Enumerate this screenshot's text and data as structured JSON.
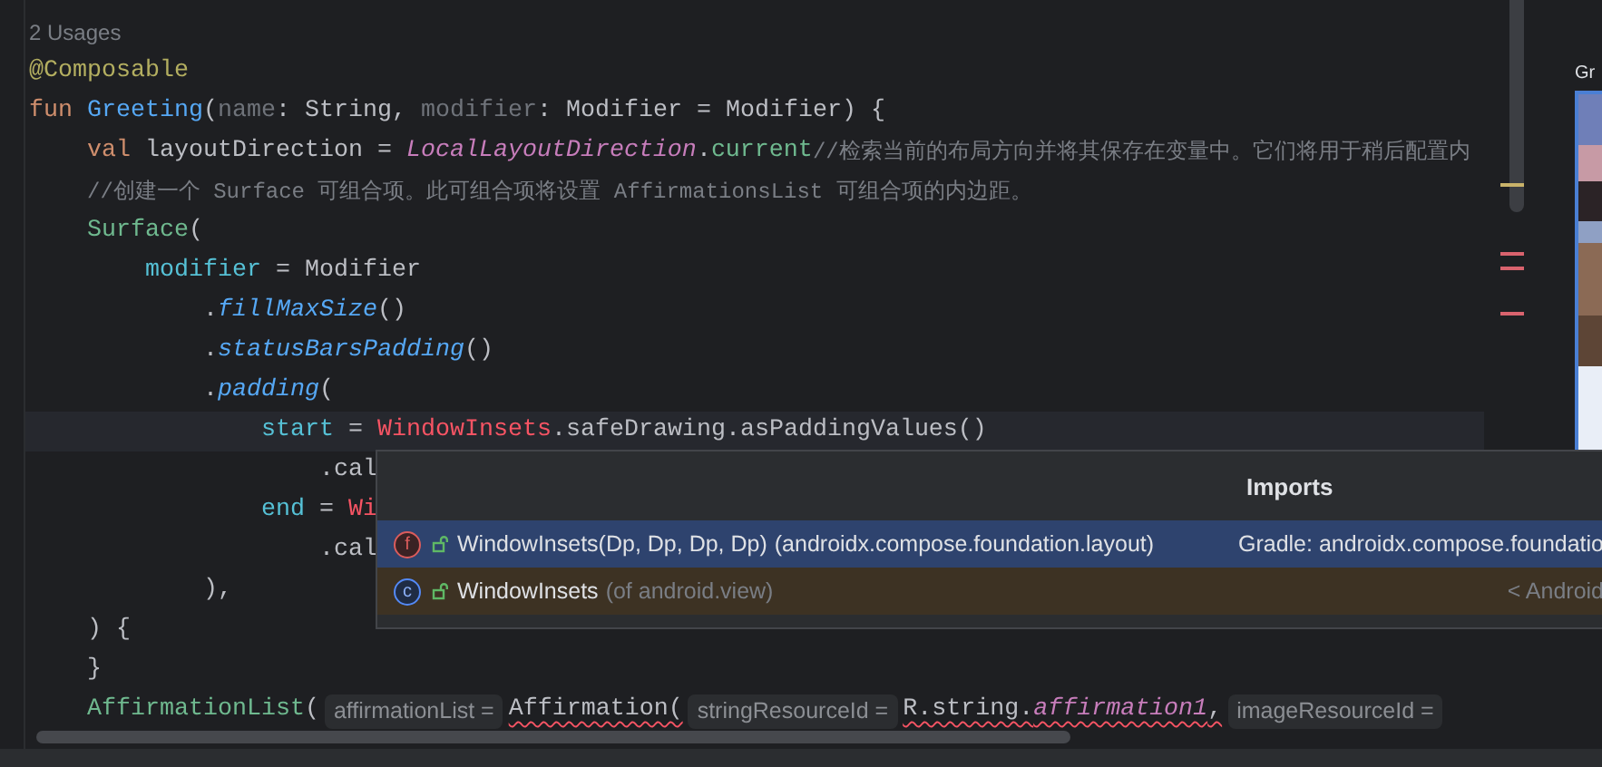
{
  "editor": {
    "usages": "2 Usages",
    "lines": [
      {
        "current": false,
        "tokens": [
          {
            "text": "@Composable",
            "kind": "annotation"
          }
        ]
      },
      {
        "current": false,
        "tokens": [
          {
            "text": "fun ",
            "kind": "keyword"
          },
          {
            "text": "Greeting",
            "kind": "function"
          },
          {
            "text": "(",
            "kind": "plain"
          },
          {
            "text": "name",
            "kind": "unused"
          },
          {
            "text": ": String, ",
            "kind": "plain"
          },
          {
            "text": "modifier",
            "kind": "unused"
          },
          {
            "text": ": Modifier = Modifier) {",
            "kind": "plain"
          }
        ],
        "children": [
          {
            "current": false,
            "tokens": [
              {
                "text": "val ",
                "kind": "keyword"
              },
              {
                "text": "layoutDirection = ",
                "kind": "plain"
              },
              {
                "text": "LocalLayoutDirection",
                "kind": "static"
              },
              {
                "text": ".",
                "kind": "plain"
              },
              {
                "text": "current",
                "kind": "composable"
              },
              {
                "text": "//检索当前的布局方向并将其保存在变量中。它们将用于稍后配置内",
                "kind": "comment"
              }
            ]
          },
          {
            "current": false,
            "tokens": [
              {
                "text": "//创建一个 Surface 可组合项。此可组合项将设置 AffirmationsList 可组合项的内边距。",
                "kind": "comment"
              }
            ]
          },
          {
            "current": false,
            "tokens": [
              {
                "text": "Surface",
                "kind": "composable"
              },
              {
                "text": "(",
                "kind": "plain"
              }
            ],
            "children": [
              {
                "current": false,
                "tokens": [
                  {
                    "text": "modifier",
                    "kind": "named"
                  },
                  {
                    "text": " = Modifier",
                    "kind": "plain"
                  }
                ],
                "children": [
                  {
                    "current": false,
                    "tokens": [
                      {
                        "text": ".",
                        "kind": "plain"
                      },
                      {
                        "text": "fillMaxSize",
                        "kind": "extension"
                      },
                      {
                        "text": "()",
                        "kind": "plain"
                      }
                    ]
                  },
                  {
                    "current": false,
                    "tokens": [
                      {
                        "text": ".",
                        "kind": "plain"
                      },
                      {
                        "text": "statusBarsPadding",
                        "kind": "extension"
                      },
                      {
                        "text": "()",
                        "kind": "plain"
                      }
                    ]
                  },
                  {
                    "current": false,
                    "tokens": [
                      {
                        "text": ".",
                        "kind": "plain"
                      },
                      {
                        "text": "padding",
                        "kind": "extension"
                      },
                      {
                        "text": "(",
                        "kind": "plain"
                      }
                    ],
                    "children": [
                      {
                        "current": true,
                        "tokens": [
                          {
                            "text": "start",
                            "kind": "named"
                          },
                          {
                            "text": " = ",
                            "kind": "plain"
                          },
                          {
                            "text": "WindowInsets",
                            "kind": "unresolved"
                          },
                          {
                            "text": ".safeDrawing.asPaddingValues()",
                            "kind": "plain"
                          }
                        ],
                        "children": [
                          {
                            "current": false,
                            "tokens": [
                              {
                                "text": ".cal",
                                "kind": "plain"
                              }
                            ]
                          }
                        ]
                      },
                      {
                        "current": false,
                        "tokens": [
                          {
                            "text": "end",
                            "kind": "named"
                          },
                          {
                            "text": " = ",
                            "kind": "plain"
                          },
                          {
                            "text": "Wi",
                            "kind": "unresolved"
                          }
                        ],
                        "children": [
                          {
                            "current": false,
                            "tokens": [
                              {
                                "text": ".cal",
                                "kind": "plain"
                              }
                            ]
                          }
                        ]
                      }
                    ]
                  },
                  {
                    "current": false,
                    "tokens": [
                      {
                        "text": "),",
                        "kind": "plain"
                      }
                    ]
                  }
                ]
              }
            ]
          },
          {
            "current": false,
            "tokens": [
              {
                "text": ") {",
                "kind": "plain"
              }
            ]
          },
          {
            "current": false,
            "tokens": [
              {
                "text": "}",
                "kind": "plain"
              }
            ]
          },
          {
            "current": false,
            "tokens": [
              {
                "text": "AffirmationList",
                "kind": "composable"
              },
              {
                "text": "(",
                "kind": "plain"
              },
              {
                "text": "affirmationList =",
                "kind": "hint"
              },
              {
                "text": "Affirmation(",
                "kind": "plain",
                "error": true
              },
              {
                "text": "stringResourceId =",
                "kind": "hint"
              },
              {
                "text": "R.string.",
                "kind": "plain",
                "error": true
              },
              {
                "text": "affirmation1",
                "kind": "static",
                "error": true
              },
              {
                "text": ",",
                "kind": "plain",
                "error": true
              },
              {
                "text": "imageResourceId =",
                "kind": "hint"
              }
            ]
          }
        ]
      }
    ]
  },
  "imports_popup": {
    "title": "Imports",
    "rows": [
      {
        "kind": "function",
        "icon_letter": "f",
        "name": "WindowInsets(Dp, Dp, Dp, Dp)",
        "detail": "(androidx.compose.foundation.layout)",
        "location": "Gradle: androidx.compose.foundatio",
        "selected": true
      },
      {
        "kind": "class",
        "icon_letter": "c",
        "name": "WindowInsets",
        "detail": "(of android.view)",
        "location": "< Android",
        "selected": false
      }
    ]
  },
  "preview": {
    "title": "Gr"
  }
}
